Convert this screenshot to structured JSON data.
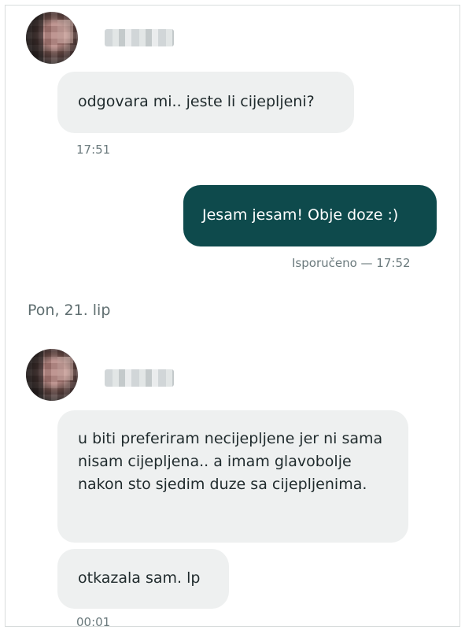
{
  "conversation": {
    "messages": [
      {
        "from": "match",
        "text": "odgovara mi.. jeste li cijepljeni?",
        "time": "17:51"
      },
      {
        "from": "me",
        "text": "Jesam jesam! Obje doze :)",
        "status_time": "Isporučeno — 17:52"
      },
      {
        "from": "match",
        "text": "u biti preferiram necijepljene jer ni sama nisam cijepljena.. a imam glavobolje nakon sto sjedim duze sa cijepljenima."
      },
      {
        "from": "match",
        "text": "otkazala sam. lp",
        "time": "00:01"
      }
    ],
    "date_separator": "Pon, 21. lip"
  },
  "colors": {
    "incoming_bubble": "#eef0f0",
    "outgoing_bubble": "#0e4a4c",
    "meta_text": "#6b7a7d"
  }
}
